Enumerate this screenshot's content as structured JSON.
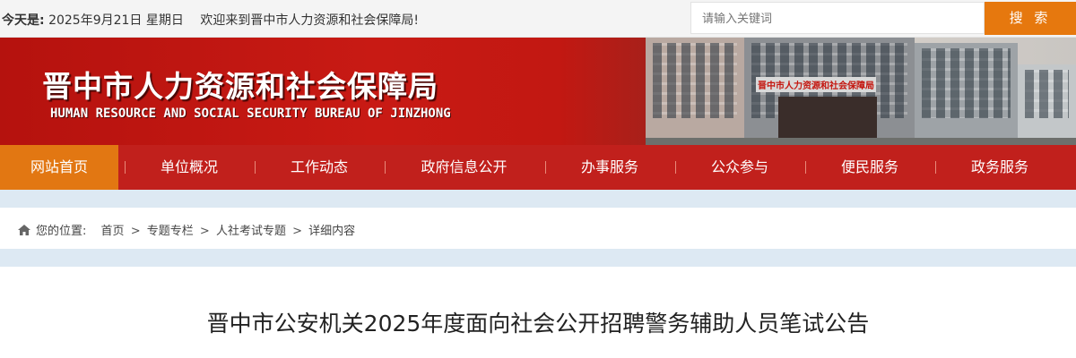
{
  "topbar": {
    "today_label": "今天是:",
    "date": "2025年9月21日 星期日",
    "welcome": "欢迎来到晋中市人力资源和社会保障局!",
    "search_placeholder": "请输入关键词",
    "search_button": "搜 索"
  },
  "banner": {
    "title": "晋中市人力资源和社会保障局",
    "subtitle": "HUMAN RESOURCE AND SOCIAL SECURITY BUREAU OF JINZHONG",
    "building_sign": "晋中市人力资源和社会保障局"
  },
  "nav": {
    "items": [
      "网站首页",
      "单位概况",
      "工作动态",
      "政府信息公开",
      "办事服务",
      "公众参与",
      "便民服务",
      "政务服务"
    ],
    "active_index": 0
  },
  "breadcrumb": {
    "label": "您的位置:",
    "items": [
      "首页",
      "专题专栏",
      "人社考试专题",
      "详细内容"
    ]
  },
  "article": {
    "title": "晋中市公安机关2025年度面向社会公开招聘警务辅助人员笔试公告"
  },
  "colors": {
    "accent": "#e6780e",
    "brand_red": "#c1201c",
    "band": "#dde9f3"
  }
}
